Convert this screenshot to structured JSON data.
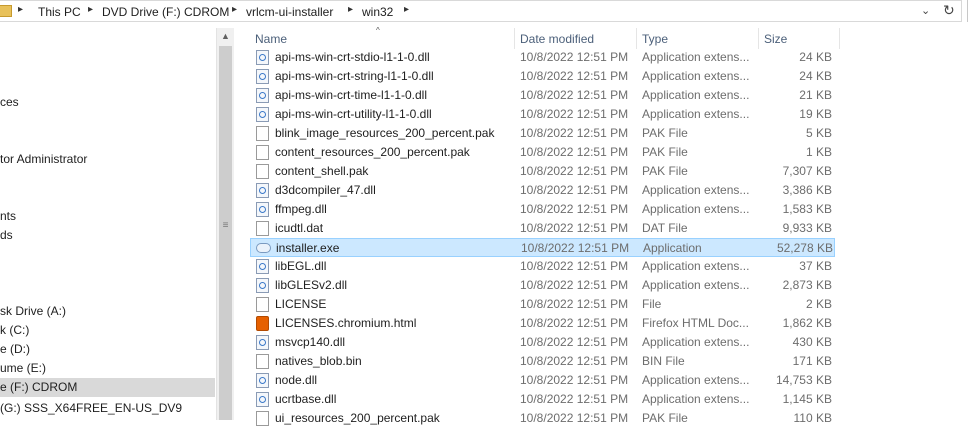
{
  "address_bar": {
    "crumbs": [
      "This PC",
      "DVD Drive (F:) CDROM",
      "vrlcm-ui-installer",
      "win32"
    ],
    "separator": "▸",
    "dropdown_glyph": "⌄",
    "refresh_glyph": "↻"
  },
  "nav_pane": {
    "items": [
      {
        "label": "ces",
        "selected": false
      },
      {
        "label": "tor Administrator",
        "selected": false
      },
      {
        "label": "nts",
        "selected": false
      },
      {
        "label": "ds",
        "selected": false
      },
      {
        "label": "sk Drive (A:)",
        "selected": false
      },
      {
        "label": "k (C:)",
        "selected": false
      },
      {
        "label": "e (D:)",
        "selected": false
      },
      {
        "label": "ume (E:)",
        "selected": false
      },
      {
        "label": "e (F:) CDROM",
        "selected": true
      },
      {
        "label": "(G:) SSS_X64FREE_EN-US_DV9",
        "selected": false
      }
    ]
  },
  "file_list": {
    "columns": {
      "name": "Name",
      "date": "Date modified",
      "type": "Type",
      "size": "Size"
    },
    "sort_glyph": "^",
    "rows": [
      {
        "icon": "dll-icon",
        "name": "api-ms-win-crt-stdio-l1-1-0.dll",
        "date": "10/8/2022 12:51 PM",
        "type": "Application extens...",
        "size": "24 KB"
      },
      {
        "icon": "dll-icon",
        "name": "api-ms-win-crt-string-l1-1-0.dll",
        "date": "10/8/2022 12:51 PM",
        "type": "Application extens...",
        "size": "24 KB"
      },
      {
        "icon": "dll-icon",
        "name": "api-ms-win-crt-time-l1-1-0.dll",
        "date": "10/8/2022 12:51 PM",
        "type": "Application extens...",
        "size": "21 KB"
      },
      {
        "icon": "dll-icon",
        "name": "api-ms-win-crt-utility-l1-1-0.dll",
        "date": "10/8/2022 12:51 PM",
        "type": "Application extens...",
        "size": "19 KB"
      },
      {
        "icon": "file-icon",
        "name": "blink_image_resources_200_percent.pak",
        "date": "10/8/2022 12:51 PM",
        "type": "PAK File",
        "size": "5 KB"
      },
      {
        "icon": "file-icon",
        "name": "content_resources_200_percent.pak",
        "date": "10/8/2022 12:51 PM",
        "type": "PAK File",
        "size": "1 KB"
      },
      {
        "icon": "file-icon",
        "name": "content_shell.pak",
        "date": "10/8/2022 12:51 PM",
        "type": "PAK File",
        "size": "7,307 KB"
      },
      {
        "icon": "dll-icon",
        "name": "d3dcompiler_47.dll",
        "date": "10/8/2022 12:51 PM",
        "type": "Application extens...",
        "size": "3,386 KB"
      },
      {
        "icon": "dll-icon",
        "name": "ffmpeg.dll",
        "date": "10/8/2022 12:51 PM",
        "type": "Application extens...",
        "size": "1,583 KB"
      },
      {
        "icon": "file-icon",
        "name": "icudtl.dat",
        "date": "10/8/2022 12:51 PM",
        "type": "DAT File",
        "size": "9,933 KB"
      },
      {
        "icon": "exe-icon",
        "name": "installer.exe",
        "date": "10/8/2022 12:51 PM",
        "type": "Application",
        "size": "52,278 KB",
        "selected": true
      },
      {
        "icon": "dll-icon",
        "name": "libEGL.dll",
        "date": "10/8/2022 12:51 PM",
        "type": "Application extens...",
        "size": "37 KB"
      },
      {
        "icon": "dll-icon",
        "name": "libGLESv2.dll",
        "date": "10/8/2022 12:51 PM",
        "type": "Application extens...",
        "size": "2,873 KB"
      },
      {
        "icon": "file-icon",
        "name": "LICENSE",
        "date": "10/8/2022 12:51 PM",
        "type": "File",
        "size": "2 KB"
      },
      {
        "icon": "html-icon",
        "name": "LICENSES.chromium.html",
        "date": "10/8/2022 12:51 PM",
        "type": "Firefox HTML Doc...",
        "size": "1,862 KB"
      },
      {
        "icon": "dll-icon",
        "name": "msvcp140.dll",
        "date": "10/8/2022 12:51 PM",
        "type": "Application extens...",
        "size": "430 KB"
      },
      {
        "icon": "file-icon",
        "name": "natives_blob.bin",
        "date": "10/8/2022 12:51 PM",
        "type": "BIN File",
        "size": "171 KB"
      },
      {
        "icon": "dll-icon",
        "name": "node.dll",
        "date": "10/8/2022 12:51 PM",
        "type": "Application extens...",
        "size": "14,753 KB"
      },
      {
        "icon": "dll-icon",
        "name": "ucrtbase.dll",
        "date": "10/8/2022 12:51 PM",
        "type": "Application extens...",
        "size": "1,145 KB"
      },
      {
        "icon": "file-icon",
        "name": "ui_resources_200_percent.pak",
        "date": "10/8/2022 12:51 PM",
        "type": "PAK File",
        "size": "110 KB"
      }
    ]
  },
  "colors": {
    "selection_bg": "#cce8ff",
    "selection_border": "#99d1ff",
    "header_text": "#4c607a"
  }
}
